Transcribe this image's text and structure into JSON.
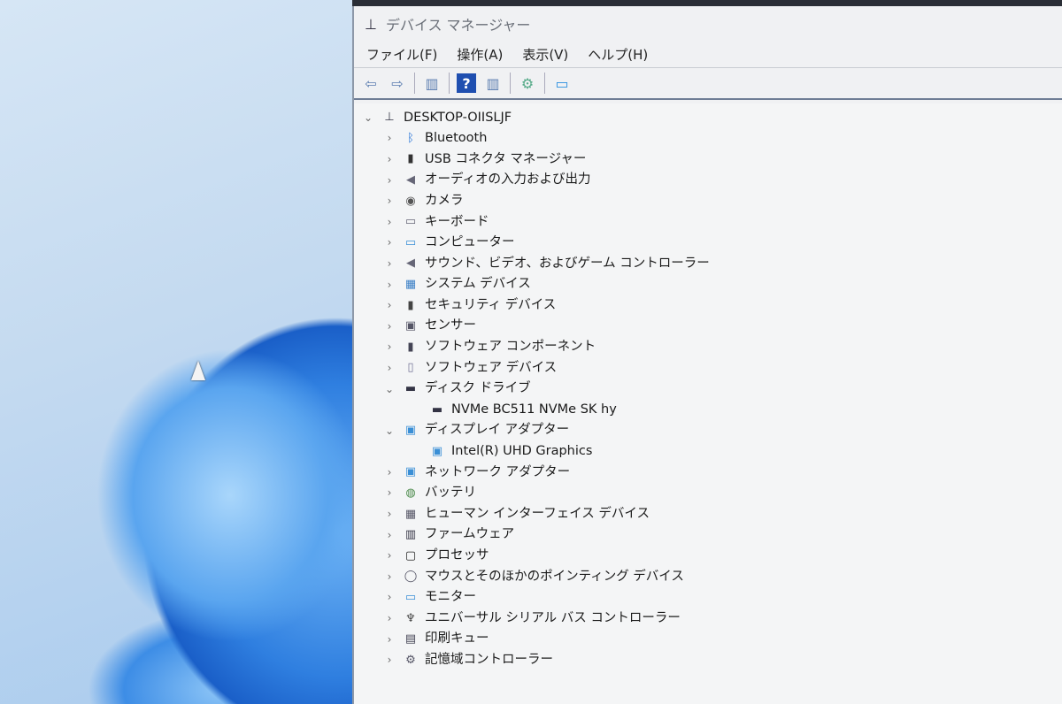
{
  "window": {
    "title": "デバイス マネージャー"
  },
  "menu": [
    "ファイル(F)",
    "操作(A)",
    "表示(V)",
    "ヘルプ(H)"
  ],
  "toolbar": [
    {
      "icon": "back-icon"
    },
    {
      "icon": "forward-icon"
    },
    {
      "icon": "show-hide-console-tree-icon"
    },
    {
      "icon": "help-icon"
    },
    {
      "icon": "properties-pane-icon"
    },
    {
      "icon": "update-driver-icon"
    },
    {
      "icon": "scan-hardware-icon"
    }
  ],
  "tree": {
    "root": "DESKTOP-OIISLJF",
    "items": [
      {
        "label": "Bluetooth",
        "icon": "bluetooth-icon",
        "glyph": "ᛒ",
        "color": "#1f6fd6",
        "expanded": false
      },
      {
        "label": "USB コネクタ マネージャー",
        "icon": "usb-icon",
        "glyph": "▮",
        "color": "#333"
      },
      {
        "label": "オーディオの入力および出力",
        "icon": "speaker-icon",
        "glyph": "◀",
        "color": "#667"
      },
      {
        "label": "カメラ",
        "icon": "camera-icon",
        "glyph": "◉",
        "color": "#555"
      },
      {
        "label": "キーボード",
        "icon": "keyboard-icon",
        "glyph": "▭",
        "color": "#667"
      },
      {
        "label": "コンピューター",
        "icon": "computer-icon",
        "glyph": "▭",
        "color": "#3a8fd6"
      },
      {
        "label": "サウンド、ビデオ、およびゲーム コントローラー",
        "icon": "sound-icon",
        "glyph": "◀",
        "color": "#667"
      },
      {
        "label": "システム デバイス",
        "icon": "system-device-icon",
        "glyph": "▦",
        "color": "#3a7fc6"
      },
      {
        "label": "セキュリティ デバイス",
        "icon": "security-device-icon",
        "glyph": "▮",
        "color": "#444"
      },
      {
        "label": "センサー",
        "icon": "sensor-icon",
        "glyph": "▣",
        "color": "#556"
      },
      {
        "label": "ソフトウェア コンポーネント",
        "icon": "software-component-icon",
        "glyph": "▮",
        "color": "#445"
      },
      {
        "label": "ソフトウェア デバイス",
        "icon": "software-device-icon",
        "glyph": "▯",
        "color": "#779"
      },
      {
        "label": "ディスク ドライブ",
        "icon": "disk-drive-icon",
        "glyph": "▬",
        "color": "#334",
        "expanded": true,
        "children": [
          {
            "label": "NVMe BC511 NVMe SK hy",
            "icon": "disk-icon",
            "glyph": "▬",
            "color": "#334"
          }
        ]
      },
      {
        "label": "ディスプレイ アダプター",
        "icon": "display-adapter-icon",
        "glyph": "▣",
        "color": "#3a8fd6",
        "expanded": true,
        "children": [
          {
            "label": "Intel(R) UHD Graphics",
            "icon": "display-icon",
            "glyph": "▣",
            "color": "#3a8fd6"
          }
        ]
      },
      {
        "label": "ネットワーク アダプター",
        "icon": "network-adapter-icon",
        "glyph": "▣",
        "color": "#3a8fd6"
      },
      {
        "label": "バッテリ",
        "icon": "battery-icon",
        "glyph": "◍",
        "color": "#4a8a4a"
      },
      {
        "label": "ヒューマン インターフェイス デバイス",
        "icon": "hid-icon",
        "glyph": "▦",
        "color": "#556"
      },
      {
        "label": "ファームウェア",
        "icon": "firmware-icon",
        "glyph": "▥",
        "color": "#334"
      },
      {
        "label": "プロセッサ",
        "icon": "processor-icon",
        "glyph": "▢",
        "color": "#222"
      },
      {
        "label": "マウスとそのほかのポインティング デバイス",
        "icon": "mouse-icon",
        "glyph": "◯",
        "color": "#556"
      },
      {
        "label": "モニター",
        "icon": "monitor-icon",
        "glyph": "▭",
        "color": "#3a8fd6"
      },
      {
        "label": "ユニバーサル シリアル バス コントローラー",
        "icon": "usb-controller-icon",
        "glyph": "♆",
        "color": "#444"
      },
      {
        "label": "印刷キュー",
        "icon": "printer-icon",
        "glyph": "▤",
        "color": "#445"
      },
      {
        "label": "記憶域コントローラー",
        "icon": "storage-controller-icon",
        "glyph": "⚙",
        "color": "#556"
      }
    ]
  }
}
